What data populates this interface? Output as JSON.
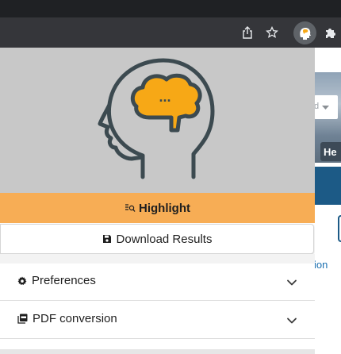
{
  "browser": {
    "toolbar_icons": [
      "share-icon",
      "star-icon",
      "extension-head-icon",
      "puzzle-icon"
    ]
  },
  "background_page": {
    "select_value": "d",
    "button_label": "He",
    "link_text": "ion"
  },
  "popup": {
    "logo_icon": "head-thought-icon",
    "logo_dots": "...",
    "colors": {
      "accent": "#f7ad55",
      "hero_bg": "#c8c8c8",
      "logo_stroke": "#3c4a50",
      "logo_fill": "#f7a816"
    },
    "highlight_button": {
      "label": "Highlight",
      "icon": "highlight-search-icon"
    },
    "download_button": {
      "label": "Download Results",
      "icon": "floppy-disk-icon"
    },
    "sections": [
      {
        "label": "Preferences",
        "icon": "gear-icon",
        "expanded": false
      },
      {
        "label": "PDF conversion",
        "icon": "pdf-icon",
        "expanded": false
      }
    ]
  }
}
